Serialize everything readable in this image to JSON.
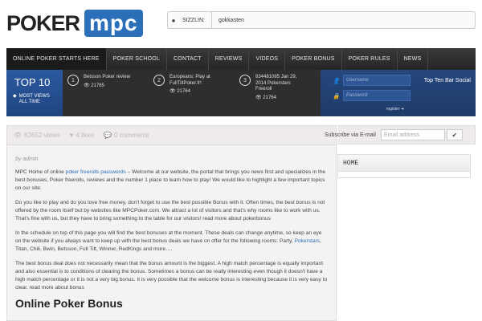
{
  "logo": {
    "poker": "POKER",
    "mpc": "mpc"
  },
  "sizzlin": {
    "label": "SIZZLIN:",
    "value": "gokkasten"
  },
  "nav": [
    "ONLINE POKER STARTS HERE",
    "POKER SCHOOL",
    "CONTACT",
    "REVIEWS",
    "VIDEOS",
    "POKER BONUS",
    "POKER RULES",
    "NEWS"
  ],
  "top10": {
    "title": "TOP 10",
    "most_views": "MOST VIEWS",
    "all_time": "ALL TIME",
    "entries": [
      {
        "num": "1",
        "title_line1": "Betsson Poker review",
        "title_line2": "",
        "title_line3": "",
        "views": "21765"
      },
      {
        "num": "2",
        "title_line1": "Europeans: Play at",
        "title_line2": "FullTiltPoker.fr!",
        "title_line3": "",
        "views": "21764"
      },
      {
        "num": "3",
        "title_line1": "834481085 Jan 29,",
        "title_line2": "2014 Pokerstars",
        "title_line3": "Freeroll",
        "views": "21764"
      }
    ]
  },
  "login": {
    "username_placeholder": "Username",
    "password_placeholder": "Password",
    "register": "register ➜"
  },
  "social": {
    "title": "Top Ten Bar Social"
  },
  "meta": {
    "views": "83652 views",
    "likes": "4 likes",
    "comments": "0 comments"
  },
  "subscribe": {
    "label": "Subscribe via E-mail",
    "placeholder": "Email address",
    "ok": "✔"
  },
  "sidebar": {
    "home": "HOME"
  },
  "article": {
    "author": "by admin",
    "p1_a": "MPC Home of online ",
    "p1_link": "poker freerolls passwords",
    "p1_b": " – Welcome at our website, the portal that brings you news first and specializes in the best bonuses, Poker freerolls, reviews and the number 1 place to learn how to play! We would like to highlight a few important topics on our site:",
    "p2": "Do you like to play and do you love free money, don't forget to use the best possible Bonus with it. Often times, the best bonus is not offered by the room itself but by websites like MPCPoker.com. We attract a lot of visitors and that's why rooms like to work with us. That's fine with us, but they have to bring something to the table for our visitors! read more about pokerbonus",
    "p3_a": "In the schedule on top of this page you will find the best bonuses at the moment. These deals can change anytime, so keep an eye on the website if you always want to keep up with the best bonus deals we have on offer for the following rooms: Party, ",
    "p3_link": "Pokerstars",
    "p3_b": ", Titan, Chili, Bwin, Betsson, Full Tilt, Winner, RedKings and more….",
    "p4": "The best bonus deal does not necessarily mean that the bonus amount is the biggest. A high match percentage is equally important and also essential is to conditions of clearing the bonus. Sometimes a bonus can be really interesting even though it doesn't have a high match percentage or it is not a very big bonus. It is very possible that the welcome bonus is interesting because it is very easy to clear. read more about bonus",
    "h1": "Online Poker Bonus"
  },
  "icons": {
    "views": "eye-icon",
    "likes": "heart-icon",
    "comments": "comment-icon"
  }
}
